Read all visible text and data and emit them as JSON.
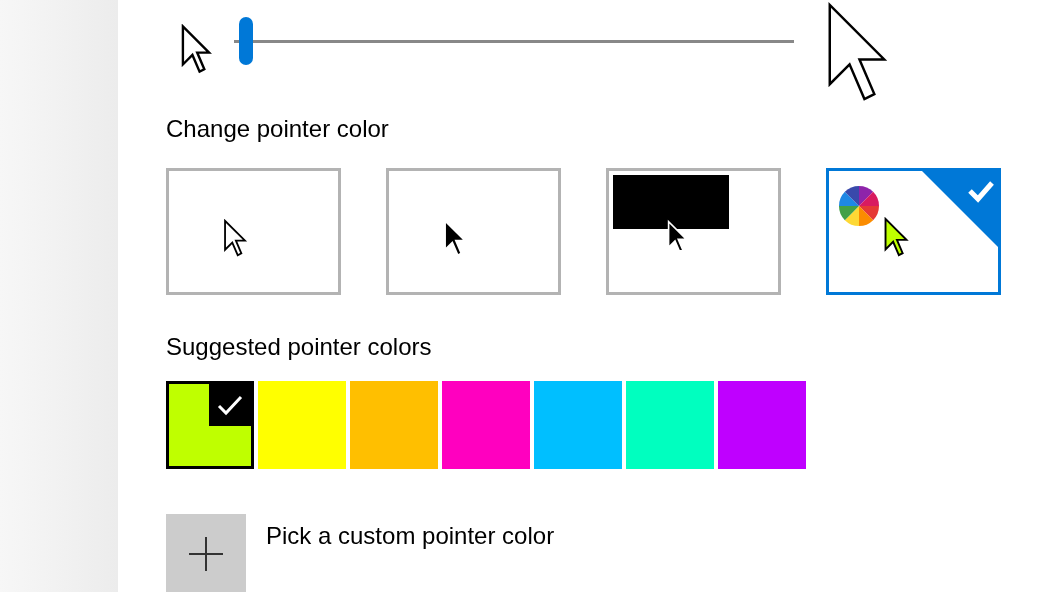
{
  "pointer_size": {
    "level": 0.01
  },
  "pointer_color": {
    "heading": "Change pointer color",
    "options": [
      {
        "kind": "white",
        "selected": false
      },
      {
        "kind": "black",
        "selected": false
      },
      {
        "kind": "inverted",
        "selected": false
      },
      {
        "kind": "custom",
        "selected": true
      }
    ]
  },
  "suggested": {
    "heading": "Suggested pointer colors",
    "colors": [
      {
        "color": "#bfff00",
        "selected": true
      },
      {
        "color": "#ffff00",
        "selected": false
      },
      {
        "color": "#ffbf00",
        "selected": false
      },
      {
        "color": "#ff00bf",
        "selected": false
      },
      {
        "color": "#00bfff",
        "selected": false
      },
      {
        "color": "#00ffbf",
        "selected": false
      },
      {
        "color": "#bf00ff",
        "selected": false
      }
    ]
  },
  "custom_color": {
    "label": "Pick a custom pointer color"
  }
}
